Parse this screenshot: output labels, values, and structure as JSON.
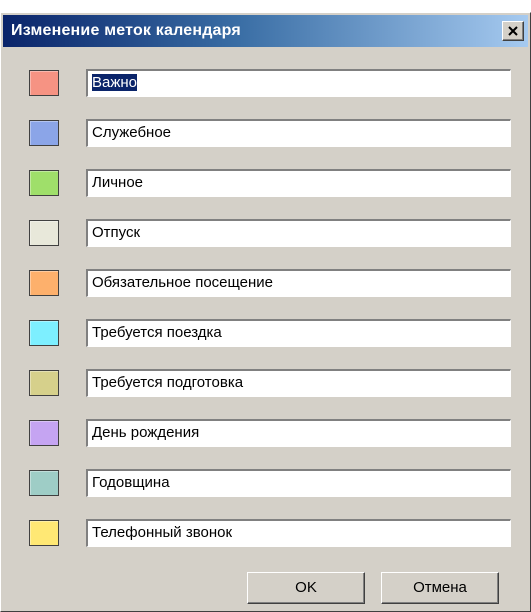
{
  "window": {
    "title": "Изменение меток календаря"
  },
  "labels": [
    {
      "name": "Важно",
      "color": "#f69383",
      "selected": true
    },
    {
      "name": "Служебное",
      "color": "#8ba5e8",
      "selected": false
    },
    {
      "name": "Личное",
      "color": "#9fdf6a",
      "selected": false
    },
    {
      "name": "Отпуск",
      "color": "#e8e8da",
      "selected": false
    },
    {
      "name": "Обязательное посещение",
      "color": "#fdb06c",
      "selected": false
    },
    {
      "name": "Требуется поездка",
      "color": "#7defff",
      "selected": false
    },
    {
      "name": "Требуется подготовка",
      "color": "#d6d08b",
      "selected": false
    },
    {
      "name": "День рождения",
      "color": "#c5a4f2",
      "selected": false
    },
    {
      "name": "Годовщина",
      "color": "#9ecdc6",
      "selected": false
    },
    {
      "name": "Телефонный звонок",
      "color": "#ffe874",
      "selected": false
    }
  ],
  "buttons": {
    "ok_label": "OK",
    "cancel_label": "Отмена"
  }
}
